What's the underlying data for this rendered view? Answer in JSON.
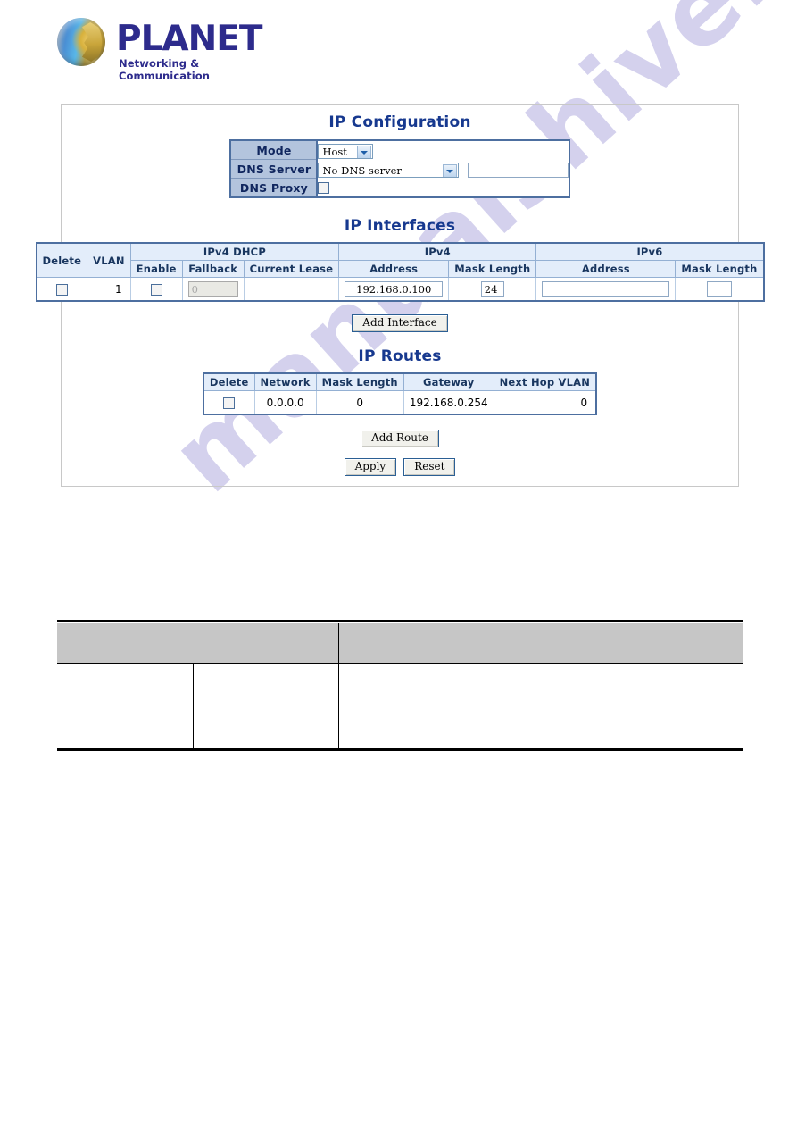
{
  "brand": {
    "name": "PLANET",
    "tagline": "Networking & Communication",
    "logo_icon": "planet-globe-icon",
    "name_color": "#2d2b8c"
  },
  "watermark": {
    "text": "manualshive.com",
    "color": "#9a93d6"
  },
  "theme": {
    "heading_color": "#17398f",
    "table_header_bg": "#e3edfa",
    "config_label_bg": "#b3c4dd",
    "table_border": "#4d6fa0",
    "doc_header_bg": "#c6c6c6"
  },
  "page": {
    "ip_configuration": {
      "title": "IP Configuration",
      "rows": [
        {
          "label": "Mode",
          "control": "select",
          "value": "Host"
        },
        {
          "label": "DNS Server",
          "control": "select+text",
          "value": "No DNS server",
          "text_value": ""
        },
        {
          "label": "DNS Proxy",
          "control": "checkbox",
          "checked": false
        }
      ]
    },
    "ip_interfaces": {
      "title": "IP Interfaces",
      "group_headers": [
        {
          "label": "Delete",
          "rowspan": 2
        },
        {
          "label": "VLAN",
          "rowspan": 2
        },
        {
          "label": "IPv4 DHCP",
          "colspan": 3
        },
        {
          "label": "IPv4",
          "colspan": 2
        },
        {
          "label": "IPv6",
          "colspan": 2
        }
      ],
      "sub_headers": [
        "Enable",
        "Fallback",
        "Current Lease",
        "Address",
        "Mask Length",
        "Address",
        "Mask Length"
      ],
      "rows": [
        {
          "delete": false,
          "vlan": "1",
          "dhcp_enable": false,
          "dhcp_fallback": "0",
          "dhcp_fallback_disabled": true,
          "current_lease": "",
          "ipv4_address": "192.168.0.100",
          "ipv4_mask_length": "24",
          "ipv6_address": "",
          "ipv6_mask_length": ""
        }
      ],
      "add_button": "Add Interface"
    },
    "ip_routes": {
      "title": "IP Routes",
      "headers": [
        "Delete",
        "Network",
        "Mask Length",
        "Gateway",
        "Next Hop VLAN"
      ],
      "rows": [
        {
          "delete": false,
          "network": "0.0.0.0",
          "mask_length": "0",
          "gateway": "192.168.0.254",
          "next_hop_vlan": "0"
        }
      ],
      "add_button": "Add Route"
    },
    "actions": {
      "apply": "Apply",
      "reset": "Reset"
    }
  }
}
